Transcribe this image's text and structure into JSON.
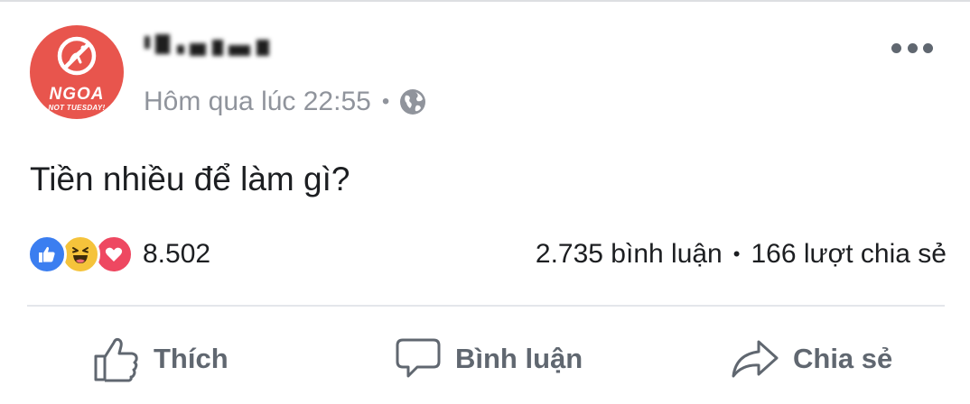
{
  "post": {
    "avatar": {
      "brand_main": "NGOA",
      "brand_sub": "NOT TUESDAY!",
      "icon": "no-sign-icon"
    },
    "meta": {
      "time": "Hôm qua lúc 22:55",
      "separator": "•",
      "privacy_icon": "globe-icon"
    },
    "more_icon": "more-options-icon",
    "text": "Tiền nhiều để làm gì?"
  },
  "reactions": {
    "icons": [
      "like-icon",
      "haha-icon",
      "love-icon"
    ],
    "count": "8.502"
  },
  "stats": {
    "comments": "2.735 bình luận",
    "separator": "•",
    "shares": "166 lượt chia sẻ"
  },
  "actions": {
    "like": "Thích",
    "comment": "Bình luận",
    "share": "Chia sẻ"
  },
  "colors": {
    "avatar_bg": "#e8554d",
    "like_blue": "#3b7ef0",
    "haha_yellow": "#f5c33b",
    "love_red": "#ee4861",
    "secondary_text": "#90949c",
    "action_text": "#606770"
  }
}
